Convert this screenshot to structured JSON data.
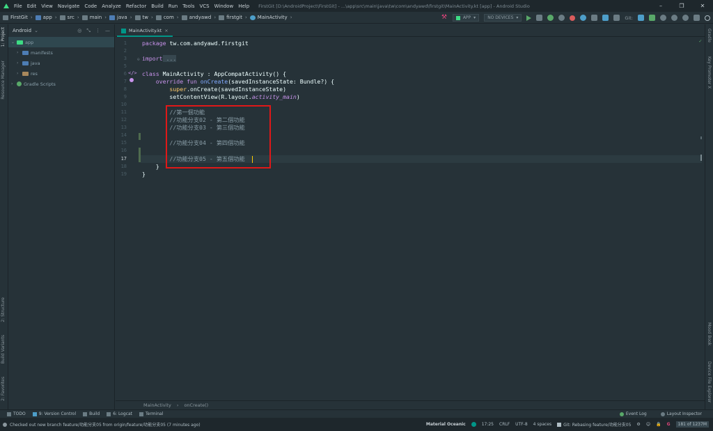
{
  "menu": {
    "items": [
      "File",
      "Edit",
      "View",
      "Navigate",
      "Code",
      "Analyze",
      "Refactor",
      "Build",
      "Run",
      "Tools",
      "VCS",
      "Window",
      "Help"
    ],
    "window_title": "FirstGit [D:\\AndroidProject\\FirstGit] - ...\\app\\src\\main\\java\\tw\\com\\andyawd\\firstgit\\MainActivity.kt [app] - Android Studio"
  },
  "nav": {
    "crumbs": [
      "FirstGit",
      "app",
      "src",
      "main",
      "java",
      "tw",
      "com",
      "andyawd",
      "firstgit",
      "MainActivity"
    ],
    "run_config": "APP",
    "device": "NO DEVICES",
    "git_label": "Git:"
  },
  "left_strip": {
    "project": "1: Project",
    "resource_manager": "Resource Manager",
    "structure": "2: Structure",
    "build_variants": "Build Variants",
    "favorites": "2: Favorites"
  },
  "right_strip": {
    "gradle": "Gradle",
    "key_promoter": "Key Promoter X",
    "mood_book": "Mood Book",
    "device_file_explorer": "Device File Explorer"
  },
  "project_panel": {
    "view_mode": "Android",
    "tree": [
      {
        "label": "app",
        "level": 0,
        "selected": true,
        "expanded": true
      },
      {
        "label": "manifests",
        "level": 1
      },
      {
        "label": "java",
        "level": 1
      },
      {
        "label": "res",
        "level": 1
      },
      {
        "label": "Gradle Scripts",
        "level": 0
      }
    ]
  },
  "editor": {
    "tab_label": "MainActivity.kt",
    "line_numbers": [
      "1",
      "2",
      "3",
      "5",
      "6",
      "7",
      "8",
      "9",
      "10",
      "11",
      "12",
      "13",
      "14",
      "15",
      "16",
      "17",
      "18",
      "19"
    ],
    "lines": {
      "l1_kw": "package",
      "l1_rest": " tw.com.andyawd.firstgit",
      "l3_kw": "import",
      "l3_rest": " ...",
      "l6_kw": "class",
      "l6_rest": " MainActivity : AppCompatActivity() {",
      "l7_kw": "    override fun",
      "l7_fn": " onCreate",
      "l7_rest": "(savedInstanceState: Bundle?) {",
      "l8_super": "        super",
      "l8_rest": ".onCreate(savedInstanceState)",
      "l9_a": "        setContentView(R.layout.",
      "l9_b": "activity_main",
      "l9_c": ")",
      "l11": "        //第一個功能",
      "l12": "        //功能分支02 - 第二個功能",
      "l13": "        //功能分支03 - 第三個功能",
      "l15": "        //功能分支04 - 第四個功能",
      "l17": "        //功能分支05 - 第五個功能",
      "l18": "    }",
      "l19": "}"
    },
    "bottom_crumb": [
      "MainActivity",
      "onCreate()"
    ]
  },
  "tool_windows": [
    "TODO",
    "9: Version Control",
    "Build",
    "6: Logcat",
    "Terminal"
  ],
  "tool_windows_right": [
    "Event Log",
    "Layout Inspector"
  ],
  "status": {
    "message": "Checked out new branch feature/功能分支05 from origin/feature/功能分支05 (7 minutes ago)",
    "theme": "Material Oceanic",
    "position": "17:25",
    "line_sep": "CRLF",
    "encoding": "UTF-8",
    "indent": "4 spaces",
    "git": "Git: Rebasing feature/功能分支05",
    "memory": "181 of 1237M"
  },
  "colors": {
    "accent": "#009688",
    "highlight_box": "#e01818",
    "bg": "#263238"
  }
}
